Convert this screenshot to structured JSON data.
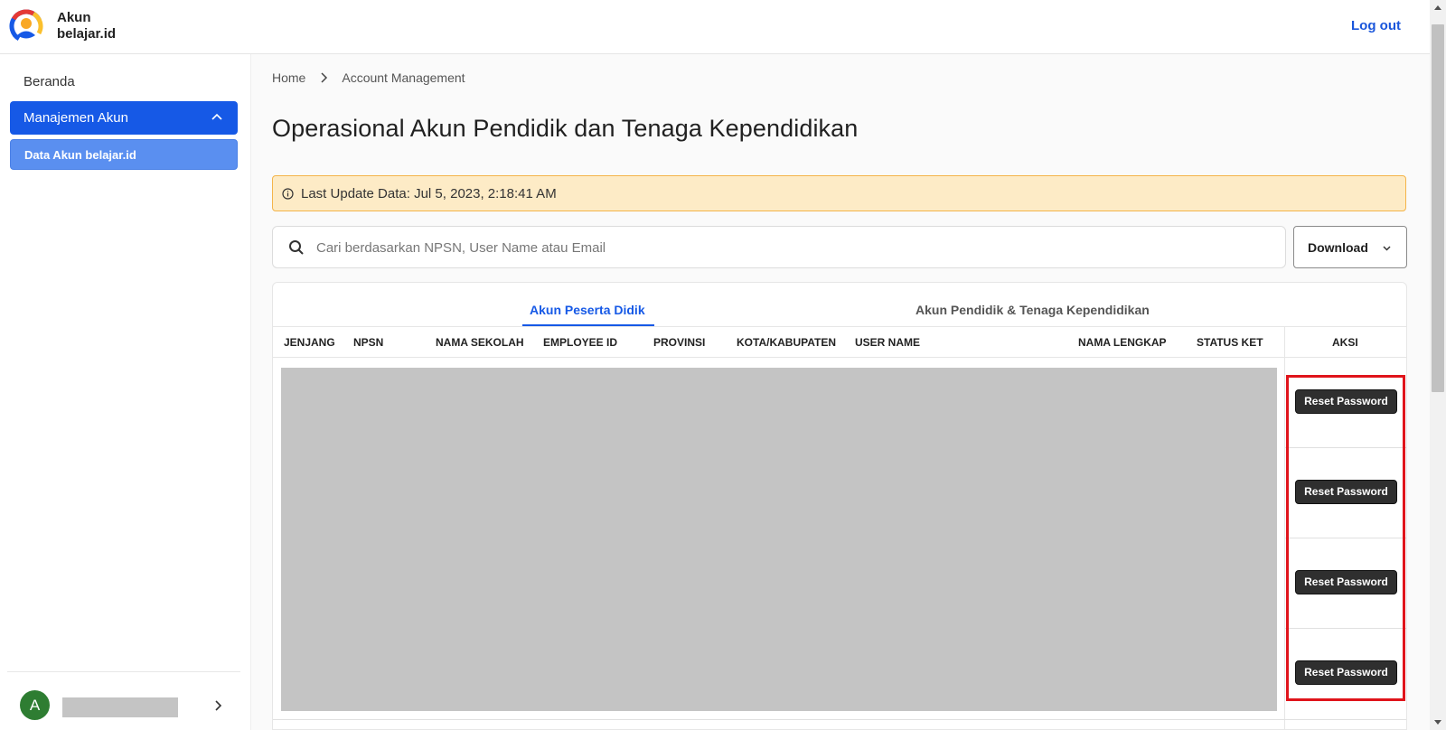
{
  "header": {
    "brand_line1": "Akun",
    "brand_line2": "belajar.id",
    "logout_label": "Log out"
  },
  "sidebar": {
    "home_label": "Beranda",
    "group_label": "Manajemen Akun",
    "sub_item_label": "Data Akun belajar.id",
    "user_initial": "A"
  },
  "breadcrumb": {
    "items": [
      "Home",
      "Account Management"
    ]
  },
  "page": {
    "title": "Operasional Akun Pendidik dan Tenaga Kependidikan",
    "last_update": "Last Update Data: Jul 5, 2023, 2:18:41 AM"
  },
  "search": {
    "placeholder": "Cari berdasarkan NPSN, User Name atau Email",
    "value": ""
  },
  "download": {
    "label": "Download"
  },
  "tabs": [
    {
      "label": "Akun Peserta Didik",
      "active": true
    },
    {
      "label": "Akun Pendidik & Tenaga Kependidikan",
      "active": false
    }
  ],
  "table": {
    "columns": [
      "JENJANG",
      "NPSN",
      "NAMA SEKOLAH",
      "EMPLOYEE ID",
      "PROVINSI",
      "KOTA/KABUPATEN",
      "USER NAME",
      "NAMA LENGKAP",
      "STATUS KET",
      "AKSI"
    ],
    "row_action_label": "Reset Password"
  },
  "colors": {
    "primary": "#1659e6",
    "sub_active": "#5a8ff0",
    "alert_bg": "#fdebc6",
    "alert_border": "#f4b44a",
    "highlight": "#e0141b",
    "button_dark": "#2f2f2f"
  },
  "icons": {
    "logo": "belajar-logo-icon",
    "chevron_up": "chevron-up-icon",
    "chevron_right": "chevron-right-icon",
    "info": "info-icon",
    "search": "search-icon",
    "chevron_down": "chevron-down-icon"
  }
}
